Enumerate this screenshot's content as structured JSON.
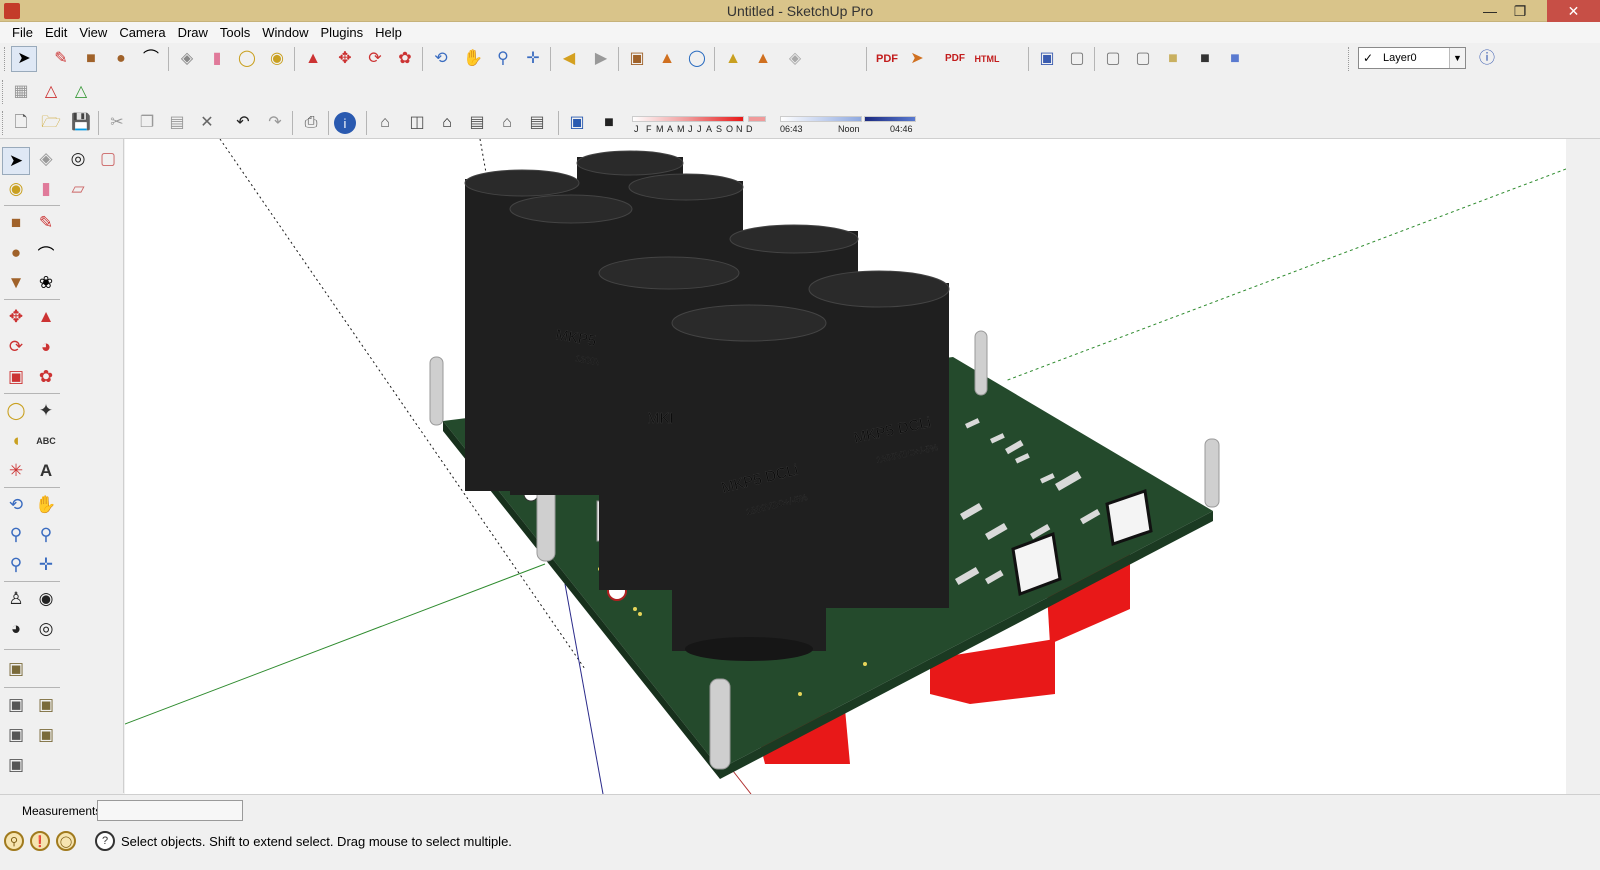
{
  "window": {
    "title": "Untitled - SketchUp Pro"
  },
  "menu": [
    "File",
    "Edit",
    "View",
    "Camera",
    "Draw",
    "Tools",
    "Window",
    "Plugins",
    "Help"
  ],
  "layers": {
    "current": "Layer0"
  },
  "shadow_settings": {
    "months": [
      "J",
      "F",
      "M",
      "A",
      "M",
      "J",
      "J",
      "A",
      "S",
      "O",
      "N",
      "D"
    ],
    "sunrise": "06:43",
    "noon": "Noon",
    "sunset": "04:46"
  },
  "measurements": {
    "label": "Measurements",
    "value": ""
  },
  "status": {
    "text": "Select objects. Shift to extend select. Drag mouse to select multiple."
  },
  "model": {
    "capacitor_marking": "MKP5 DCLi",
    "capacitor_rating": "1300VDC+/-5%",
    "colors": {
      "pcb": "#244a2c",
      "capacitor": "#1f1f1f",
      "connector": "#e81818",
      "standoff": "#cfcfcf",
      "axis_green": "#2e8b2e",
      "axis_red": "#b03030",
      "axis_blue": "#2a2a8a"
    }
  },
  "icons": {
    "toolbar_main": [
      "select-icon",
      "pencil-icon",
      "rectangle-icon",
      "circle-icon",
      "arc-icon",
      "make-component-icon",
      "eraser-icon",
      "tape-measure-icon",
      "paint-bucket-icon",
      "push-pull-icon",
      "move-icon",
      "rotate-icon",
      "follow-me-icon",
      "orbit-icon",
      "pan-icon",
      "zoom-icon",
      "zoom-extents-icon",
      "previous-view-icon",
      "next-view-icon",
      "get-models-icon",
      "share-model-icon",
      "share-component-icon",
      "extension-warehouse-icon"
    ],
    "views": [
      "iso-view-icon",
      "top-view-icon",
      "front-view-icon",
      "right-view-icon",
      "back-view-icon",
      "left-view-icon"
    ],
    "styles": [
      "xray-icon",
      "wireframe-icon",
      "hidden-line-icon",
      "shaded-icon",
      "shaded-textures-icon",
      "monochrome-icon"
    ]
  }
}
